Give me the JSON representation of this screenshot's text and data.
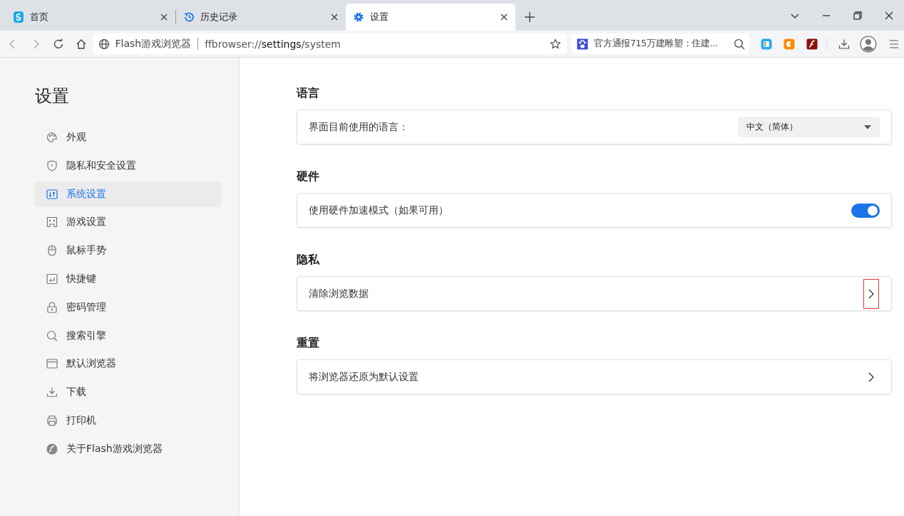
{
  "tabs": [
    {
      "title": "首页",
      "selected": false
    },
    {
      "title": "历史记录",
      "selected": false
    },
    {
      "title": "设置",
      "selected": true
    }
  ],
  "address_bar": {
    "site_name": "Flash游戏浏览器",
    "url_parts": [
      {
        "text": "ffbrowser://",
        "strong": false
      },
      {
        "text": "settings",
        "strong": true
      },
      {
        "text": "/system",
        "strong": false
      }
    ]
  },
  "news_search": {
    "text": "官方通报715万建雕塑：住建..."
  },
  "sidebar": {
    "title": "设置",
    "items": [
      {
        "label": "外观",
        "selected": false
      },
      {
        "label": "隐私和安全设置",
        "selected": false
      },
      {
        "label": "系统设置",
        "selected": true
      },
      {
        "label": "游戏设置",
        "selected": false
      },
      {
        "label": "鼠标手势",
        "selected": false
      },
      {
        "label": "快捷键",
        "selected": false
      },
      {
        "label": "密码管理",
        "selected": false
      },
      {
        "label": "搜索引擎",
        "selected": false
      },
      {
        "label": "默认浏览器",
        "selected": false
      },
      {
        "label": "下载",
        "selected": false
      },
      {
        "label": "打印机",
        "selected": false
      },
      {
        "label": "关于Flash游戏浏览器",
        "selected": false
      }
    ]
  },
  "sections": [
    {
      "title": "语言",
      "rows": [
        {
          "kind": "dropdown",
          "label": "界面目前使用的语言：",
          "value": "中文（简体）"
        }
      ]
    },
    {
      "title": "硬件",
      "rows": [
        {
          "kind": "toggle",
          "label": "使用硬件加速模式（如果可用）",
          "on": true
        }
      ]
    },
    {
      "title": "隐私",
      "rows": [
        {
          "kind": "link",
          "label": "清除浏览数据",
          "highlighted": true
        }
      ]
    },
    {
      "title": "重置",
      "rows": [
        {
          "kind": "link",
          "label": "将浏览器还原为默认设置",
          "highlighted": false
        }
      ]
    }
  ]
}
